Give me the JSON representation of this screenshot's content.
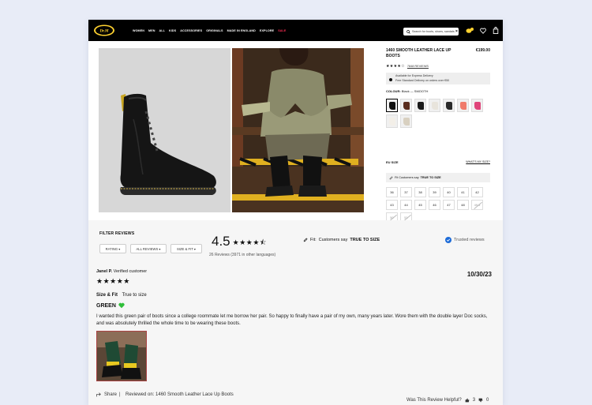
{
  "brand": {
    "logo_text": "Dr. Martens",
    "accent": "#ffd230",
    "sale_color": "#ff2d55"
  },
  "nav": {
    "links": [
      "WOMEN",
      "MEN",
      "ALL",
      "KIDS",
      "ACCESSORIES",
      "ORIGINALS",
      "MADE IN ENGLAND",
      "EXPLORE",
      "SALE"
    ],
    "search_placeholder": "Search for boots, shoes, sandals etc",
    "icons": [
      "search-icon",
      "rewards-icon",
      "wishlist-icon",
      "bag-icon"
    ],
    "rewards_badge": "0"
  },
  "product": {
    "title": "1460 SMOOTH LEATHER LACE UP BOOTS",
    "price": "€199.00",
    "stars": "★★★★☆",
    "reviews_link": "7848 REVIEWS",
    "delivery_line1": "Available for Express Delivery",
    "delivery_line2": "Free Standard Delivery on orders over €50",
    "colour_label": "COLOUR:",
    "colour_value": "Black — SMOOTH",
    "swatch_colors": [
      "#111111",
      "#5a2d1e",
      "#1a1a1a",
      "#e8e4dc",
      "#2a2a2a",
      "#f07b6b",
      "#e0457a",
      "#f3efe8",
      "#d8d0c0"
    ],
    "size_label": "EU SIZE",
    "size_guide": "WHAT'S MY SIZE?",
    "fit_text": "Fit Customers say",
    "fit_value": "TRUE TO SIZE",
    "sizes": [
      "36",
      "37",
      "38",
      "39",
      "40",
      "41",
      "42",
      "43",
      "44",
      "45",
      "46",
      "47",
      "48",
      "49.5",
      "50",
      "51"
    ],
    "unavailable_sizes": [
      "49.5",
      "50",
      "51"
    ],
    "add_to_bag": "ADD TO BAG"
  },
  "reviews": {
    "filter_label": "FILTER REVIEWS",
    "filters": [
      "RATING ▾",
      "ALL REVIEWS ▾",
      "SIZE & FIT ▾"
    ],
    "average": "4.5",
    "average_stars": "★★★★⯪",
    "count_text": "26 Reviews (3971 in other languages)",
    "fit_prefix": "Fit:",
    "fit_summary": "Customers say",
    "fit_summary_value": "TRUE TO SIZE",
    "trusted": "Trusted reviews",
    "items": [
      {
        "author": "Janel P.",
        "verified": "Verified customer",
        "stars": "★★★★★",
        "date": "10/30/23",
        "size_fit_label": "Size & Fit",
        "size_fit_value": "True to size",
        "title": "GREEN",
        "body": "I wanted this green pair of boots since a college roommate let me borrow her pair. So happy to finally have a pair of my own, many years later. Wore them with the double layer Doc socks, and was absolutely thrilled the whole time to be wearing these boots.",
        "share": "Share",
        "reviewed_on_label": "Reviewed on:",
        "reviewed_on_value": "1460 Smooth Leather Lace Up Boots",
        "helpful_label": "Was This Review Helpful?",
        "helpful_yes": "3",
        "helpful_no": "0"
      }
    ]
  }
}
